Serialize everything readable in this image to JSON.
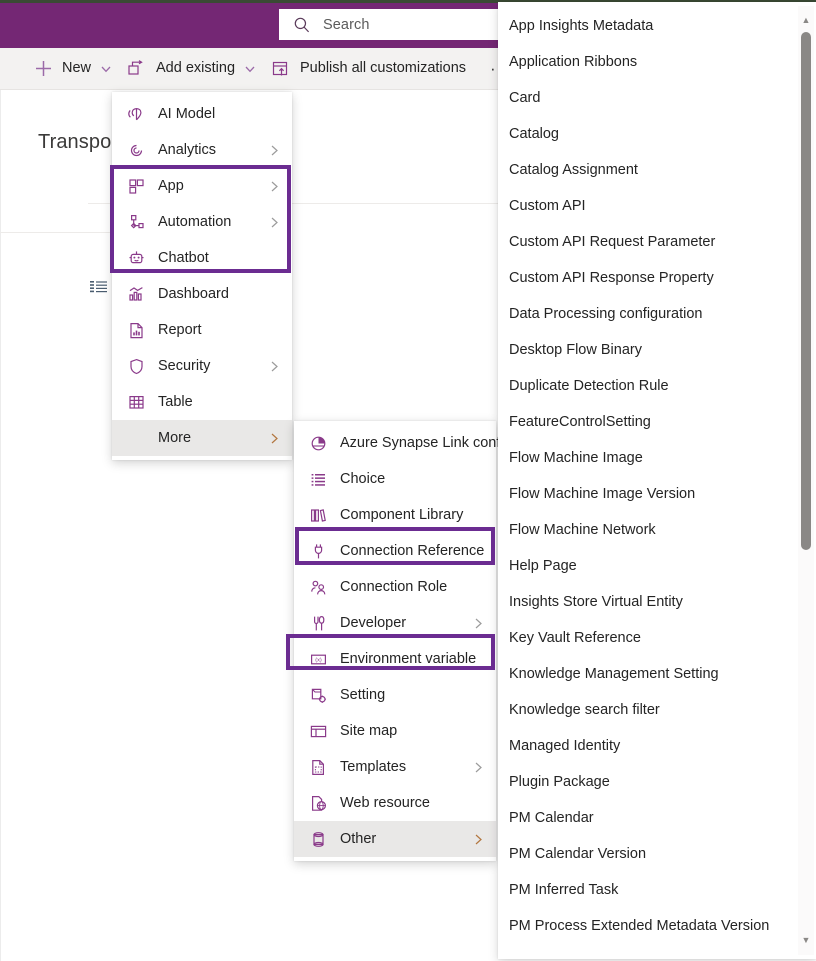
{
  "app": {
    "page_title": "Transport",
    "brand_color": "#742774",
    "highlight_color": "#6b2c91",
    "icon_color": "#8a3a8a"
  },
  "search": {
    "placeholder": "Search",
    "value": "",
    "icon": "search-icon"
  },
  "commandbar": {
    "items": [
      {
        "label": "New",
        "icon": "plus-icon",
        "has_caret": true
      },
      {
        "label": "Add existing",
        "icon": "add-existing-icon",
        "has_caret": true
      },
      {
        "label": "Publish all customizations",
        "icon": "publish-icon",
        "has_caret": false
      }
    ],
    "overflow_label": "···"
  },
  "new_menu": {
    "items": [
      {
        "label": "AI Model",
        "icon": "ai-model-icon",
        "submenu": false,
        "hover": false
      },
      {
        "label": "Analytics",
        "icon": "analytics-icon",
        "submenu": true,
        "hover": false
      },
      {
        "label": "App",
        "icon": "app-icon",
        "submenu": true,
        "hover": false
      },
      {
        "label": "Automation",
        "icon": "automation-icon",
        "submenu": true,
        "hover": false
      },
      {
        "label": "Chatbot",
        "icon": "chatbot-icon",
        "submenu": false,
        "hover": false
      },
      {
        "label": "Dashboard",
        "icon": "dashboard-icon",
        "submenu": false,
        "hover": false
      },
      {
        "label": "Report",
        "icon": "report-icon",
        "submenu": false,
        "hover": false
      },
      {
        "label": "Security",
        "icon": "shield-icon",
        "submenu": true,
        "hover": false
      },
      {
        "label": "Table",
        "icon": "table-icon",
        "submenu": false,
        "hover": false
      },
      {
        "label": "More",
        "icon": "none",
        "submenu": true,
        "hover": true
      }
    ]
  },
  "more_menu": {
    "items": [
      {
        "label": "Azure Synapse Link config",
        "icon": "synapse-icon",
        "submenu": false,
        "hover": false
      },
      {
        "label": "Choice",
        "icon": "choice-icon",
        "submenu": false,
        "hover": false
      },
      {
        "label": "Component Library",
        "icon": "component-lib-icon",
        "submenu": false,
        "hover": false
      },
      {
        "label": "Connection Reference",
        "icon": "plug-icon",
        "submenu": false,
        "hover": false
      },
      {
        "label": "Connection Role",
        "icon": "people-icon",
        "submenu": false,
        "hover": false
      },
      {
        "label": "Developer",
        "icon": "developer-icon",
        "submenu": true,
        "hover": false
      },
      {
        "label": "Environment variable",
        "icon": "env-variable-icon",
        "submenu": false,
        "hover": false
      },
      {
        "label": "Setting",
        "icon": "setting-icon",
        "submenu": false,
        "hover": false
      },
      {
        "label": "Site map",
        "icon": "site-map-icon",
        "submenu": false,
        "hover": false
      },
      {
        "label": "Templates",
        "icon": "templates-icon",
        "submenu": true,
        "hover": false
      },
      {
        "label": "Web resource",
        "icon": "web-resource-icon",
        "submenu": false,
        "hover": false
      },
      {
        "label": "Other",
        "icon": "other-icon",
        "submenu": true,
        "hover": true
      }
    ]
  },
  "other_list": {
    "items": [
      "App Insights Metadata",
      "Application Ribbons",
      "Card",
      "Catalog",
      "Catalog Assignment",
      "Custom API",
      "Custom API Request Parameter",
      "Custom API Response Property",
      "Data Processing configuration",
      "Desktop Flow Binary",
      "Duplicate Detection Rule",
      "FeatureControlSetting",
      "Flow Machine Image",
      "Flow Machine Image Version",
      "Flow Machine Network",
      "Help Page",
      "Insights Store Virtual Entity",
      "Key Vault Reference",
      "Knowledge Management Setting",
      "Knowledge search filter",
      "Managed Identity",
      "Plugin Package",
      "PM Calendar",
      "PM Calendar Version",
      "PM Inferred Task",
      "PM Process Extended Metadata Version"
    ],
    "scroll_up_glyph": "▲",
    "scroll_down_glyph": "▼"
  },
  "annotations": [
    {
      "name": "app-automation-chatbot-highlight",
      "color": "#6b2c91"
    },
    {
      "name": "connection-reference-highlight",
      "color": "#6b2c91"
    },
    {
      "name": "environment-variable-highlight",
      "color": "#6b2c91"
    }
  ]
}
